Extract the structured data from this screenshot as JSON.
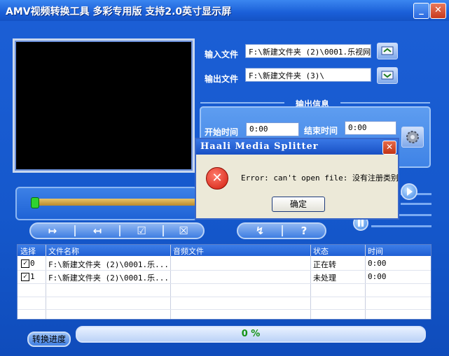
{
  "window": {
    "title": "AMV视频转换工具  多彩专用版 支持2.0英寸显示屏",
    "min_glyph": "_",
    "close_glyph": "✕"
  },
  "files": {
    "input_label": "输入文件",
    "input_value": "F:\\新建文件夹 (2)\\0001.乐视网·",
    "output_label": "输出文件",
    "output_value": "F:\\新建文件夹 (3)\\"
  },
  "output_info": {
    "title": "输出信息",
    "start_label": "开始时间",
    "start_value": "0:00",
    "end_label": "结束时间",
    "end_value": "0:00"
  },
  "controls": {
    "mark_in": "↦",
    "mark_out": "↤",
    "check": "☑",
    "uncheck": "☒",
    "refresh": "↯",
    "help": "?"
  },
  "table": {
    "headers": [
      "选择",
      "文件名称",
      "音频文件",
      "状态",
      "时间"
    ],
    "rows": [
      {
        "index": "0",
        "checked": "✓",
        "file": "F:\\新建文件夹 (2)\\0001.乐...",
        "audio": "",
        "status": "正在转",
        "time": "0:00"
      },
      {
        "index": "1",
        "checked": "✓",
        "file": "F:\\新建文件夹 (2)\\0001.乐...",
        "audio": "",
        "status": "未处理",
        "time": "0:00"
      }
    ]
  },
  "progress": {
    "button_label": "转换进度",
    "percent_text": "0 %",
    "value": 0
  },
  "dialog": {
    "title": "Haali Media Splitter",
    "message": "Error: can't open file: 没有注册类别",
    "ok_label": "确定",
    "close_glyph": "✕",
    "icon_glyph": "✕"
  },
  "colors": {
    "window_blue": "#1558cc",
    "titlebar": "#1a5fd8",
    "progress_text": "#149214",
    "error_red": "#d11d0e"
  },
  "icons": [
    "open-input-icon",
    "open-output-icon",
    "settings-gear-icon",
    "play-icon",
    "pause-icon",
    "error-icon"
  ]
}
